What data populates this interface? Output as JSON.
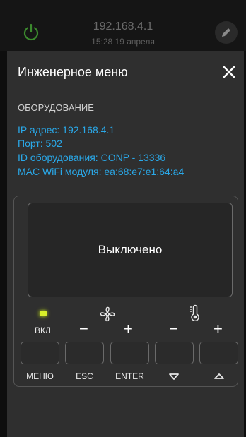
{
  "header": {
    "ip": "192.168.4.1",
    "time_date": "15:28   19 апреля"
  },
  "dialog": {
    "title": "Инженерное меню",
    "section_title": "ОБОРУДОВАНИЕ",
    "info": {
      "ip": "IP адрес: 192.168.4.1",
      "port": "Порт: 502",
      "equipment_id": "ID оборудования: CONP - 13336",
      "mac": "MAC WiFi модуля: ea:68:e7:e1:64:a4"
    }
  },
  "panel": {
    "screen_text": "Выключено",
    "on_label": "ВКЛ",
    "led_color": "#d8f02a",
    "minus": "−",
    "plus": "+",
    "buttons": {
      "menu": "МЕНЮ",
      "esc": "ESC",
      "enter": "ENTER"
    }
  },
  "colors": {
    "accent_text": "#2aa8e8",
    "power_icon": "#3c8a2e"
  }
}
